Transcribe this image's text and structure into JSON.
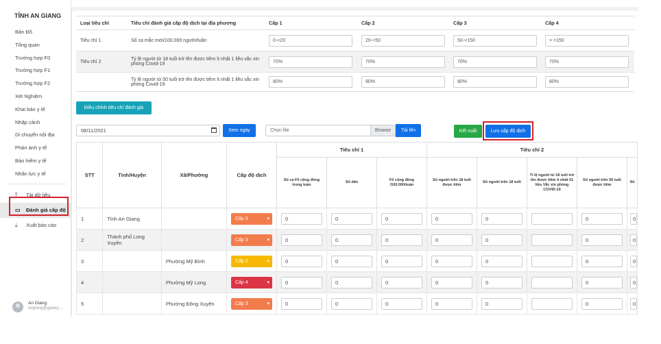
{
  "sidebar": {
    "brand": "TỈNH AN GIANG",
    "items": [
      "Bản Đồ",
      "Tổng quan",
      "Trường hợp F0",
      "Trường hợp F1",
      "Trường hợp F2",
      "Xét Nghiệm",
      "Khai báo y tế",
      "Nhập cảnh",
      "Di chuyển nội địa",
      "Phản ánh y tế",
      "Bảo hiểm y tế",
      "Nhân lực y tế"
    ],
    "tools": [
      {
        "icon": "upload-icon",
        "label": "Tải dữ liệu"
      },
      {
        "icon": "inbox-icon",
        "label": "Đánh giá cấp độ"
      },
      {
        "icon": "download-icon",
        "label": "Xuất báo cáo"
      }
    ],
    "user": {
      "name": "An Giang",
      "email": "angiang@galaxy...."
    }
  },
  "criteria_table": {
    "headers": [
      "Loại tiêu chí",
      "Tiêu chí đánh giá cấp độ dịch tại địa phương",
      "Cấp 1",
      "Cấp 2",
      "Cấp 3",
      "Cấp 4"
    ],
    "rows": [
      {
        "type": "Tiêu chí 1",
        "desc": "Số ca mắc mới/100.000 người/tuần",
        "levels": [
          "0-<20",
          "20-<50",
          "50-<150",
          "> =150"
        ]
      },
      {
        "type": "Tiêu chí 2",
        "desc": "Tỷ lệ người từ 18 tuổi trở lên được tiêm ít nhất 1 liều vắc xin phòng Covid-19",
        "levels": [
          "70%",
          "70%",
          "70%",
          "70%"
        ]
      },
      {
        "type": "",
        "desc": "Tỷ lệ người từ 50 tuổi trở lên được tiêm ít nhất 1 liều vắc xin phòng Covid-19",
        "levels": [
          "80%",
          "80%",
          "80%",
          "80%"
        ]
      }
    ]
  },
  "controls": {
    "adjust_button": "Điều chỉnh tiêu chí đánh giá",
    "date_value": "08/11/2021",
    "view_button": "Xem ngày",
    "file_placeholder": "Chọn file",
    "browse_label": "Browse",
    "upload_button": "Tải lên",
    "export_button": "Kết xuất",
    "save_button": "Lưu cấp độ dịch"
  },
  "level_table": {
    "headers": {
      "stt": "STT",
      "province": "Tỉnh/Huyện",
      "ward": "Xã/Phường",
      "level": "Cấp độ dịch",
      "group1": "Tiêu chí 1",
      "group2": "Tiêu chí 2",
      "sub": [
        "Số ca F0 cộng đồng trong tuần",
        "Số dân",
        "F0 cộng đồng /100.000/tuần",
        "Số người trên 18 tuổi được tiêm",
        "Số người trên 18 tuổi",
        "Tỉ lệ người từ 18 tuổi trở lên được tiêm ít nhất 01 liều Vắc xin phòng COVID-19",
        "Số người trên 50 tuổi được tiêm",
        "Số"
      ]
    },
    "rows": [
      {
        "stt": "1",
        "province": "Tỉnh An Giang",
        "ward": "",
        "level": "Cấp 3",
        "color": "#f37c4c"
      },
      {
        "stt": "2",
        "province": "Thành phố Long Xuyên",
        "ward": "",
        "level": "Cấp 3",
        "color": "#f37c4c"
      },
      {
        "stt": "3",
        "province": "",
        "ward": "Phường Mỹ Bình",
        "level": "Cấp 2",
        "color": "#f6b900"
      },
      {
        "stt": "4",
        "province": "",
        "ward": "Phường Mỹ Long",
        "level": "Cấp 4",
        "color": "#dc3545"
      },
      {
        "stt": "5",
        "province": "",
        "ward": "Phường Đông Xuyên",
        "level": "Cấp 3",
        "color": "#f37c4c"
      }
    ],
    "cell_value": "0"
  }
}
